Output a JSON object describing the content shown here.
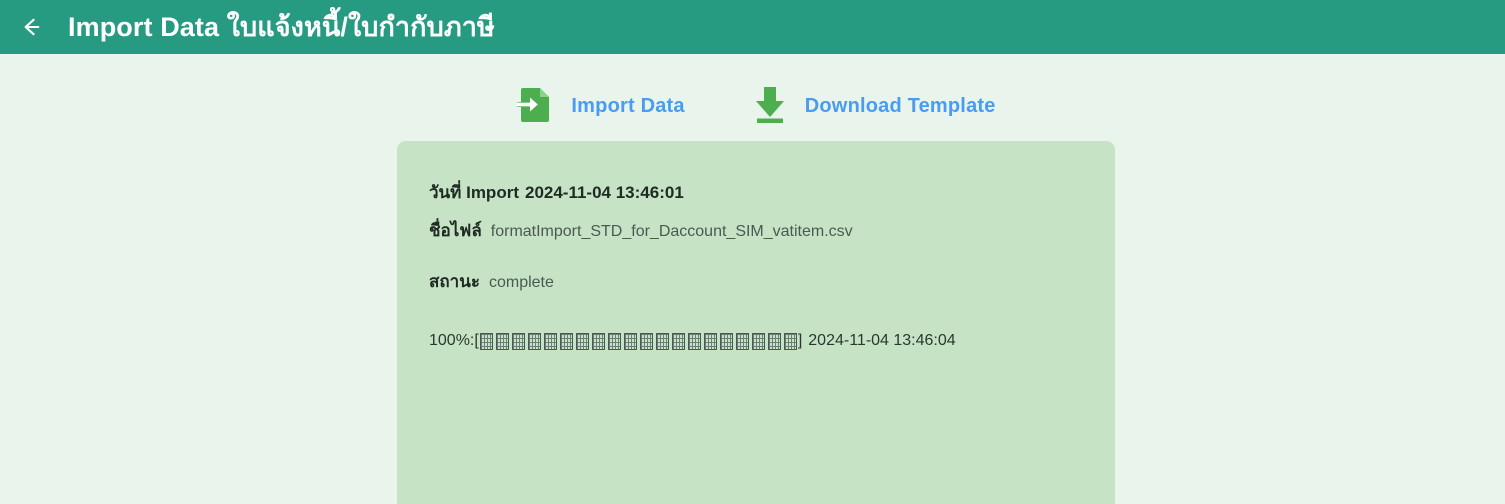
{
  "header": {
    "back_icon": "arrow-left-icon",
    "title": "Import Data ใบแจ้งหนี้/ใบกำกับภาษี",
    "background_color": "#279b81",
    "title_color": "#ffffff"
  },
  "toolbar": {
    "actions": [
      {
        "icon": "file-import-icon",
        "label": "Import Data",
        "color": "#4a9cf0"
      },
      {
        "icon": "download-icon",
        "label": "Download Template",
        "color": "#4a9cf0"
      }
    ]
  },
  "panel": {
    "background_color": "#c6e3c6",
    "import_date_label": "วันที่ Import",
    "import_date_value": "2024-11-04 13:46:01",
    "file_name_label": "ชื่อไฟล์",
    "file_name_value": "formatImport_STD_for_Daccount_SIM_vatitem.csv",
    "status_label": "สถานะ",
    "status_value": "complete",
    "progress": {
      "percent_text": "100%:",
      "bracket_open": "[",
      "bracket_close": "]",
      "block_count": 20,
      "block_glyph": "missing-glyph-box",
      "timestamp": "2024-11-04 13:46:04"
    }
  },
  "page": {
    "background_color": "#e8f4ec"
  }
}
